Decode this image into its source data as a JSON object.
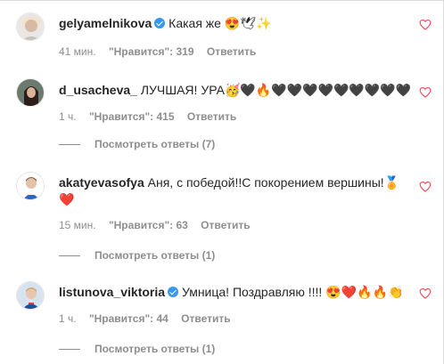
{
  "comments": [
    {
      "username": "gelyamelnikova",
      "verified": true,
      "text": "Какая же 😍🕊✨",
      "time": "41 мин.",
      "likes": "\"Нравится\": 319",
      "reply": "Ответить",
      "view_replies": ""
    },
    {
      "username": "d_usacheva_",
      "verified": false,
      "text": "ЛУЧШАЯ! УРА🥳🖤🔥🖤🖤🖤🖤🖤🖤🖤🖤🖤",
      "time": "1 ч.",
      "likes": "\"Нравится\": 415",
      "reply": "Ответить",
      "view_replies": "Посмотреть ответы (7)"
    },
    {
      "username": "akatyevasofya",
      "verified": false,
      "text": "Аня, с победой!!С покорением вершины!🏅",
      "text_line2": "❤️",
      "time": "15 мин.",
      "likes": "\"Нравится\": 63",
      "reply": "Ответить",
      "view_replies": "Посмотреть ответы (1)"
    },
    {
      "username": "listunova_viktoria",
      "verified": true,
      "text": "Умница! Поздравляю !!!! 😍❤️🔥🔥👏",
      "time": "1 ч.",
      "likes": "\"Нравится\": 44",
      "reply": "Ответить",
      "view_replies": "Посмотреть ответы (1)"
    }
  ],
  "colors": {
    "heart": "#ed4956",
    "verified": "#3897f0",
    "meta": "#8e8e8e",
    "text": "#262626"
  },
  "icons": [
    "heart-outline-icon",
    "verified-badge-icon"
  ]
}
